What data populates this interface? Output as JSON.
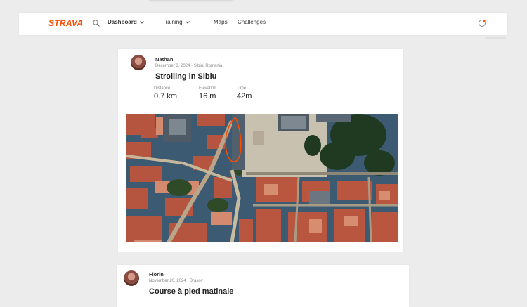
{
  "app": {
    "logo": "STRAVA"
  },
  "navbar": {
    "menu": [
      {
        "label": "Dashboard",
        "has_dropdown": true,
        "bold": true
      },
      {
        "label": "Training",
        "has_dropdown": true,
        "bold": false
      },
      {
        "label": "Maps",
        "has_dropdown": false,
        "bold": false
      },
      {
        "label": "Challenges",
        "has_dropdown": false,
        "bold": false
      }
    ],
    "search_icon": "search-icon",
    "right_icon": "notification-icon",
    "accent": "#fc4c02"
  },
  "feed": {
    "activity1": {
      "athlete": "Nathan",
      "meta": "December 3, 2024 · Sibiu, Romania",
      "title": "Strolling in Sibiu",
      "stats": [
        {
          "label": "Distance",
          "value": "0.7 km"
        },
        {
          "label": "Elevation",
          "value": "16 m"
        },
        {
          "label": "Time",
          "value": "42m"
        }
      ]
    },
    "activity2": {
      "athlete": "Florin",
      "meta": "November 20, 2024 · Brasov",
      "title": "Course à pied matinale"
    }
  }
}
